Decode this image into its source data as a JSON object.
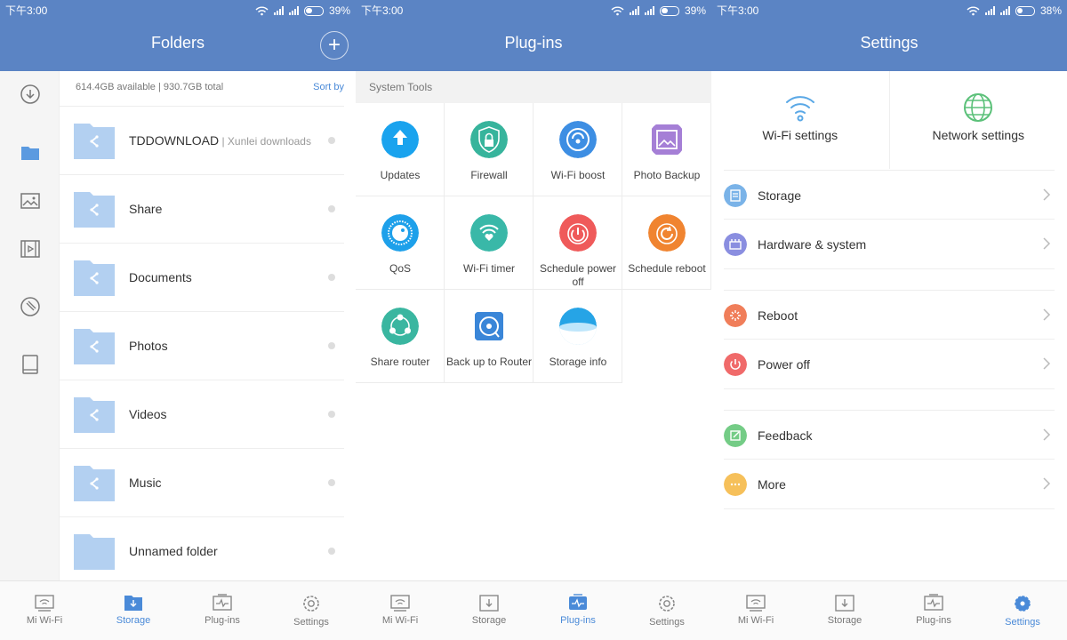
{
  "status_bars": [
    {
      "time": "下午3:00",
      "battery": "39%",
      "battery_level": 0.39
    },
    {
      "time": "下午3:00",
      "battery": "39%",
      "battery_level": 0.39
    },
    {
      "time": "下午3:00",
      "battery": "38%",
      "battery_level": 0.38
    }
  ],
  "folders": {
    "title": "Folders",
    "add_label": "+",
    "storage_info": "614.4GB available | 930.7GB total",
    "sort_label": "Sort by",
    "items": [
      {
        "name": "TDDOWNLOAD",
        "sub": " | Xunlei downloads",
        "shared": true
      },
      {
        "name": "Share",
        "sub": "",
        "shared": true
      },
      {
        "name": "Documents",
        "sub": "",
        "shared": true
      },
      {
        "name": "Photos",
        "sub": "",
        "shared": true
      },
      {
        "name": "Videos",
        "sub": "",
        "shared": true
      },
      {
        "name": "Music",
        "sub": "",
        "shared": true
      },
      {
        "name": "Unnamed folder",
        "sub": "",
        "shared": false
      }
    ]
  },
  "plugins": {
    "title": "Plug-ins",
    "section": "System Tools",
    "tools": [
      {
        "label": "Updates",
        "color": "#1aa3ee",
        "icon": "arrow-up-icon"
      },
      {
        "label": "Firewall",
        "color": "#37b49c",
        "icon": "shield-lock-icon"
      },
      {
        "label": "Wi-Fi boost",
        "color": "#3d8ee3",
        "icon": "speed-gauge-icon"
      },
      {
        "label": "Photo Backup",
        "color": "#a57fd6",
        "icon": "photo-icon"
      },
      {
        "label": "QoS",
        "color": "#1ea0ea",
        "icon": "qos-dial-icon"
      },
      {
        "label": "Wi-Fi timer",
        "color": "#39b8a8",
        "icon": "wifi-heart-icon"
      },
      {
        "label": "Schedule power off",
        "color": "#ef5a5a",
        "icon": "power-timer-icon"
      },
      {
        "label": "Schedule reboot",
        "color": "#f08430",
        "icon": "reboot-timer-icon"
      },
      {
        "label": "Share router",
        "color": "#3ab6a0",
        "icon": "share-nodes-icon"
      },
      {
        "label": "Back up to Router",
        "color": "#3a86d8",
        "icon": "disk-backup-icon"
      },
      {
        "label": "Storage info",
        "color": "#26a4e6",
        "icon": "bowl-icon"
      }
    ]
  },
  "settings": {
    "title": "Settings",
    "quick": [
      {
        "label": "Wi-Fi settings",
        "icon": "wifi-icon",
        "color": "#5aa8e6"
      },
      {
        "label": "Network settings",
        "icon": "globe-icon",
        "color": "#5cc17a"
      }
    ],
    "rows": [
      {
        "label": "Storage",
        "color": "#7ab3e8",
        "icon": "storage-icon"
      },
      {
        "label": "Hardware & system",
        "color": "#8a8ee0",
        "icon": "hardware-icon"
      },
      {
        "label": "Reboot",
        "color": "#f07e5a",
        "icon": "reboot-icon"
      },
      {
        "label": "Power off",
        "color": "#f06a6a",
        "icon": "power-icon"
      },
      {
        "label": "Feedback",
        "color": "#74cc86",
        "icon": "feedback-icon"
      },
      {
        "label": "More",
        "color": "#f6c05a",
        "icon": "more-icon"
      }
    ]
  },
  "tabs": [
    "Mi Wi-Fi",
    "Storage",
    "Plug-ins",
    "Settings"
  ],
  "active_tab": [
    1,
    2,
    3
  ],
  "accent": "#4a8ad8",
  "header_color": "#5b84c4"
}
